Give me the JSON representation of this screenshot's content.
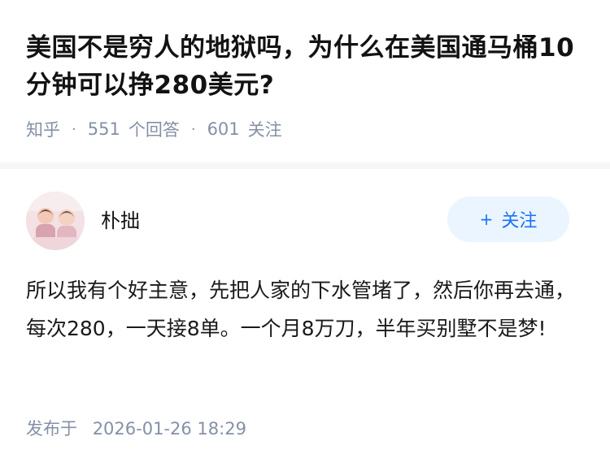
{
  "question": {
    "title": "美国不是穷人的地狱吗，为什么在美国通马桶10分钟可以挣280美元?"
  },
  "meta": {
    "source": "知乎",
    "answers_count": "551",
    "answers_label": "个回答",
    "followers_count": "601",
    "followers_label": "关注",
    "separator": "·"
  },
  "author": {
    "name": "朴拙",
    "follow_label": "+ 关注",
    "follow_plus": "+",
    "follow_text": "关注"
  },
  "answer": {
    "content": "所以我有个好主意，先把人家的下水管堵了，然后你再去通，每次280，一天接8单。一个月8万刀，半年买别墅不是梦!"
  },
  "footer": {
    "published_label": "发布于",
    "published_time": "2026-01-26 18:29"
  },
  "colors": {
    "meta_gray": "#8590a6",
    "follow_blue": "#1772f6",
    "follow_bg": "#ebf5ff"
  }
}
